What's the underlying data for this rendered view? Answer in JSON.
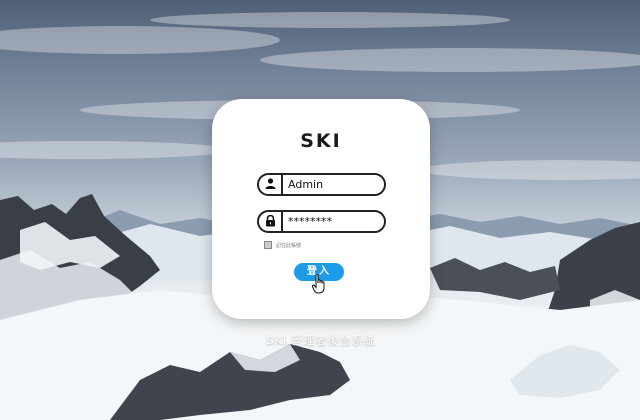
{
  "login": {
    "title": "SKI",
    "username_value": "Admin",
    "password_value": "********",
    "remember_label": "記住此帳號",
    "submit_label": "登入"
  },
  "footer": {
    "subtitle": "SKI.管理者後台系統"
  },
  "icons": {
    "username": "user-icon",
    "password": "lock-icon",
    "cursor": "hand-pointer-icon"
  },
  "colors": {
    "button": "#1e9be6",
    "card": "#ffffff",
    "border": "#222222"
  }
}
